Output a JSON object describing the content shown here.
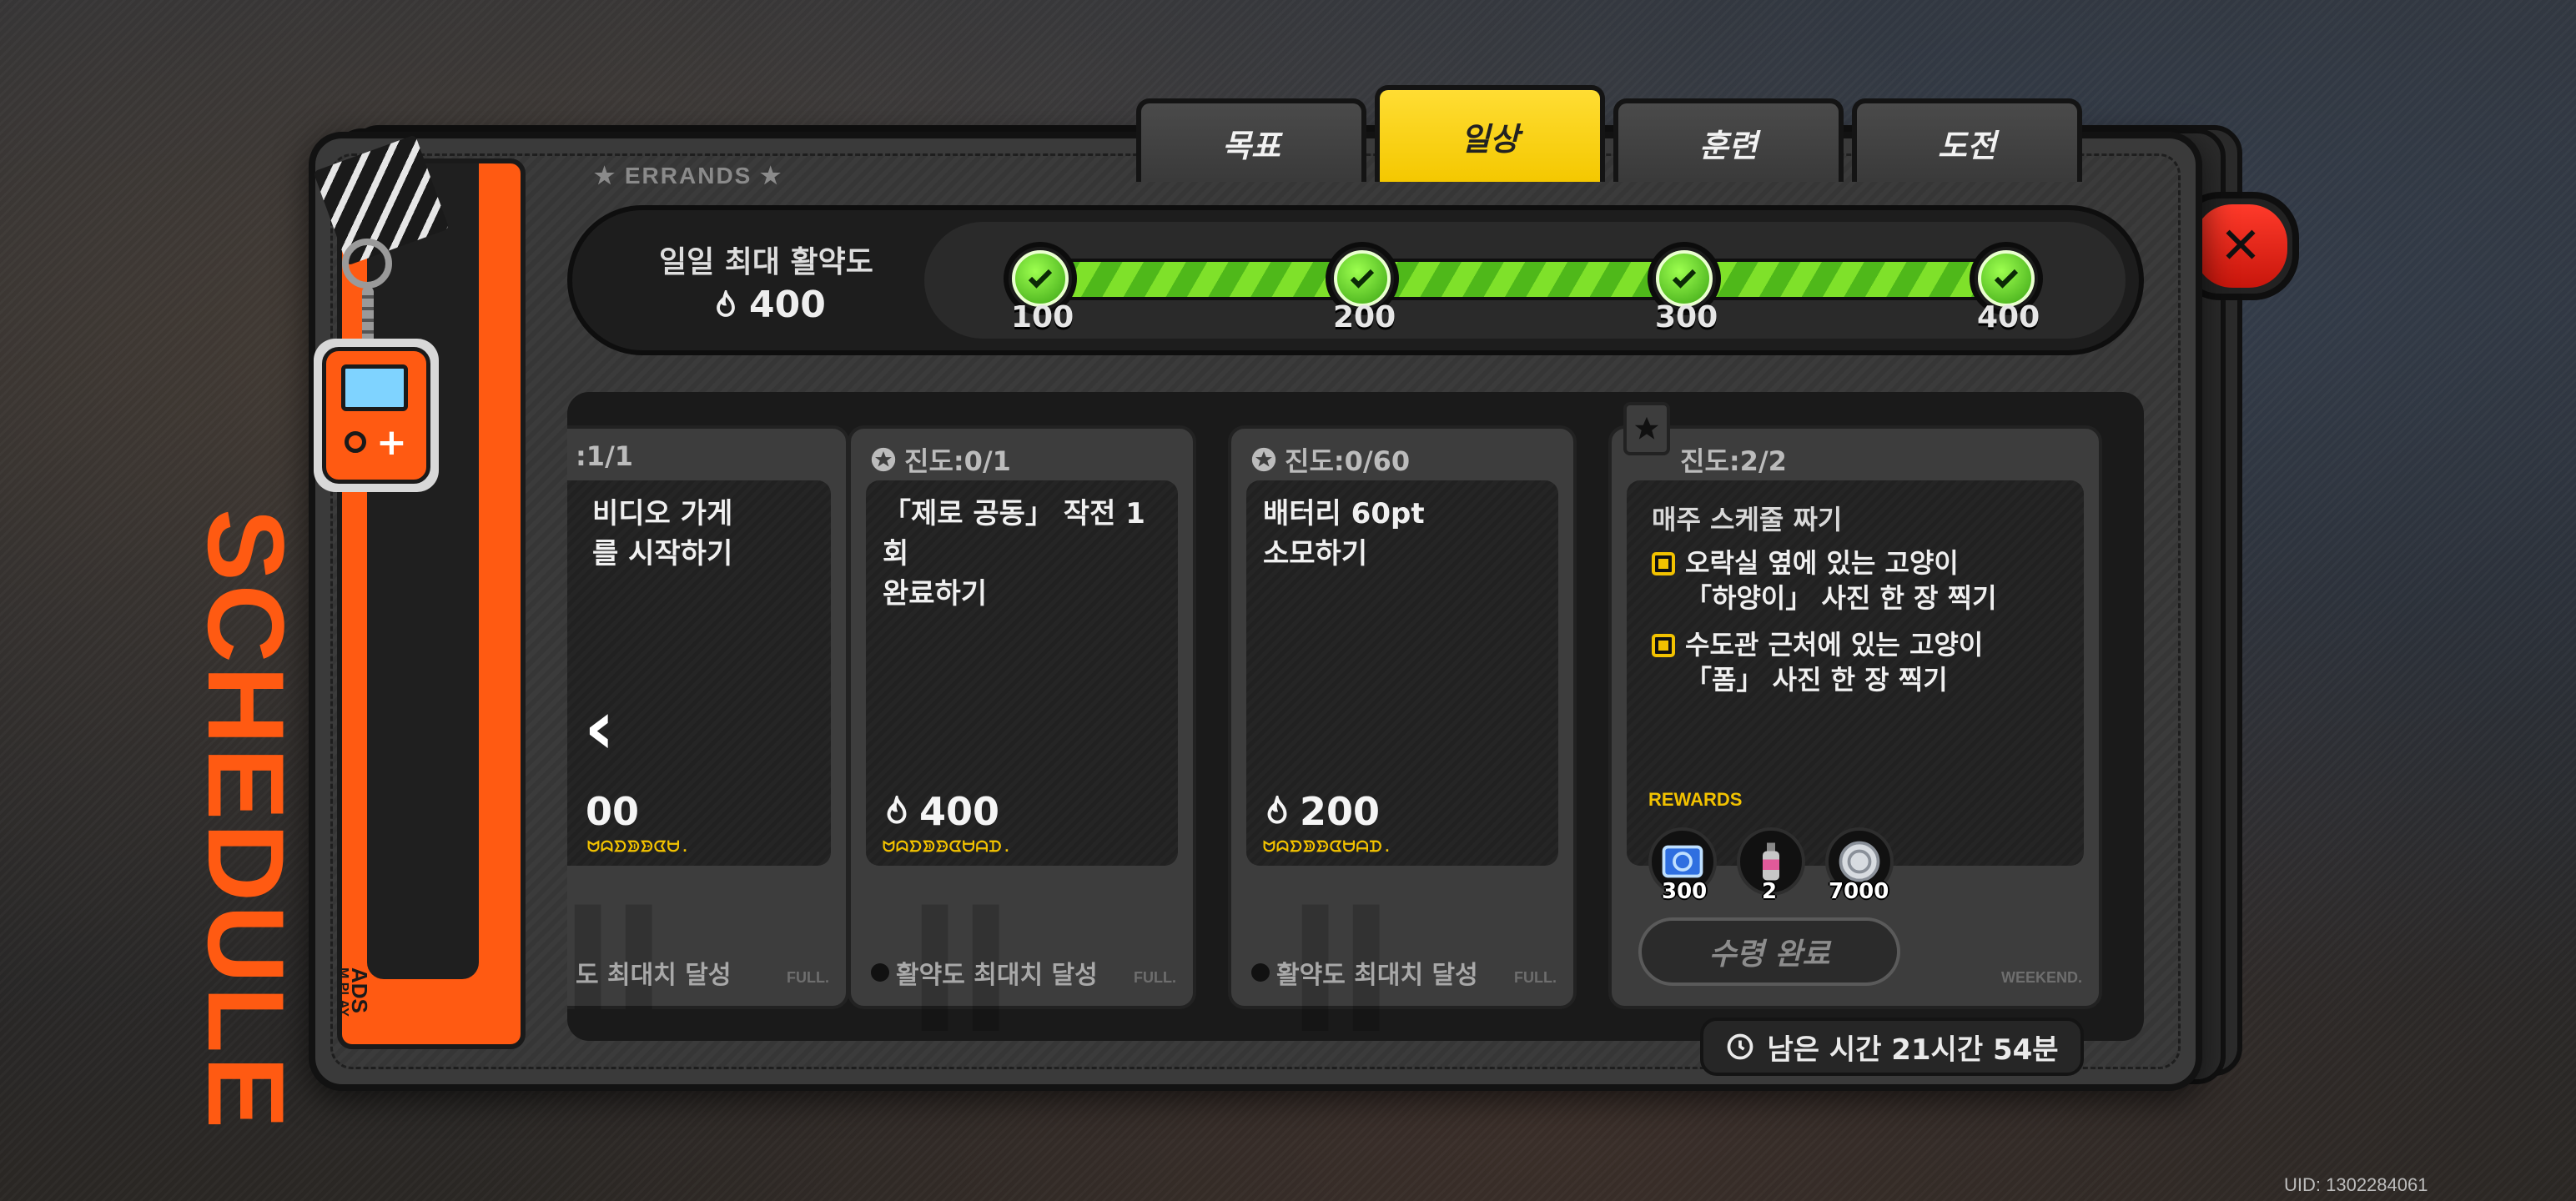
{
  "tabs": [
    {
      "label": "목표",
      "active": false
    },
    {
      "label": "일상",
      "active": true
    },
    {
      "label": "훈련",
      "active": false
    },
    {
      "label": "도전",
      "active": false
    }
  ],
  "section_label": "★ ERRANDS ★",
  "activity": {
    "title": "일일 최대 활약도",
    "value": "400",
    "progress_fraction": 1.0,
    "milestones": [
      "100",
      "200",
      "300",
      "400"
    ]
  },
  "banner": {
    "title": "SCHEDULE",
    "sub_left": "ADS",
    "sub_right": "M PLAY"
  },
  "cards": [
    {
      "progress": ":1/1",
      "description": "비디오 가게\n를 시작하기",
      "points": "00",
      "deco": "ᗢᗣᗤᗥᗦᗧᗨ.",
      "footer": "도 최대치 달성",
      "footer_tag": "FULL."
    },
    {
      "progress": "진도:0/1",
      "description": "「제로 공동」 작전 1회\n완료하기",
      "points": "400",
      "deco": "ᗢᗣᗤᗥᗦᗧᗨᗩᗪ.",
      "footer": "활약도 최대치 달성",
      "footer_tag": "FULL."
    },
    {
      "progress": "진도:0/60",
      "description": "배터리 60pt\n소모하기",
      "points": "200",
      "deco": "ᗢᗣᗤᗥᗦᗧᗨᗩᗪ.",
      "footer": "활약도 최대치 달성",
      "footer_tag": "FULL."
    }
  ],
  "weekly_card": {
    "progress": "진도:2/2",
    "title": "매주 스케줄 짜기",
    "tasks": [
      "오락실 옆에 있는 고양이\n「하양이」 사진 한 장 찍기",
      "수도관 근처에 있는 고양이\n「폼」 사진 한 장 찍기"
    ],
    "rewards_label": "REWARDS",
    "rewards": [
      {
        "icon": "blue-ticket-icon",
        "count": "300"
      },
      {
        "icon": "spray-can-icon",
        "count": "2"
      },
      {
        "icon": "silver-coin-icon",
        "count": "7000"
      }
    ],
    "claim_label": "수령 완료",
    "footer_tag": "WEEKEND."
  },
  "timer": "남은 시간 21시간 54분",
  "uid": "UID: 1302284061",
  "colors": {
    "accent_yellow": "#f4c800",
    "accent_orange": "#ff5a12",
    "progress_green": "#7fe12a",
    "close_red": "#e0200f"
  }
}
